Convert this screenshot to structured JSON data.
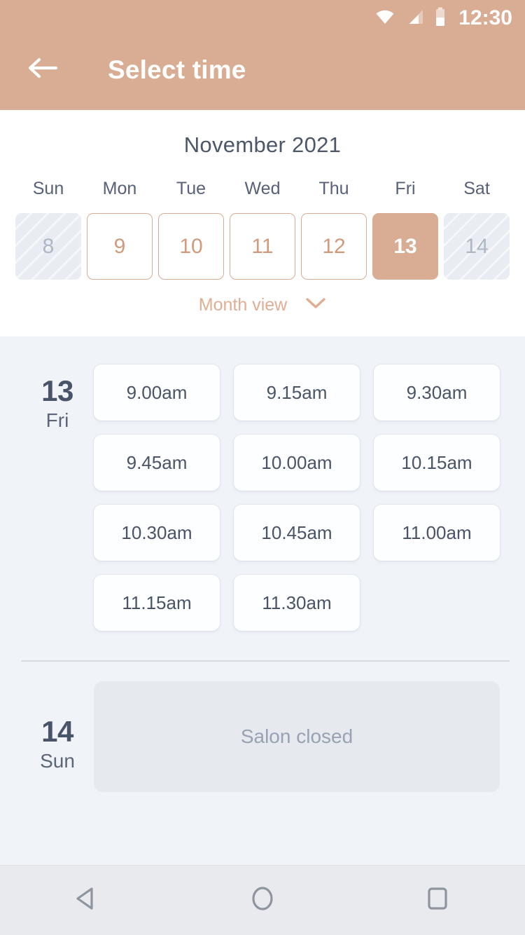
{
  "status_bar": {
    "time": "12:30",
    "icons": [
      "wifi-icon",
      "cellular-signal-icon",
      "battery-icon"
    ]
  },
  "app_bar": {
    "back_icon": "arrow-left-icon",
    "title": "Select time"
  },
  "calendar": {
    "month_title": "November 2021",
    "weekday_headers": [
      "Sun",
      "Mon",
      "Tue",
      "Wed",
      "Thu",
      "Fri",
      "Sat"
    ],
    "days": [
      {
        "number": "8",
        "state": "disabled"
      },
      {
        "number": "9",
        "state": "available"
      },
      {
        "number": "10",
        "state": "available"
      },
      {
        "number": "11",
        "state": "available"
      },
      {
        "number": "12",
        "state": "available"
      },
      {
        "number": "13",
        "state": "selected"
      },
      {
        "number": "14",
        "state": "disabled"
      }
    ],
    "month_view_toggle": {
      "label": "Month view",
      "icon": "chevron-down-icon"
    }
  },
  "schedule": {
    "days": [
      {
        "day_number": "13",
        "day_name": "Fri",
        "slots": [
          "9.00am",
          "9.15am",
          "9.30am",
          "9.45am",
          "10.00am",
          "10.15am",
          "10.30am",
          "10.45am",
          "11.00am",
          "11.15am",
          "11.30am"
        ]
      },
      {
        "day_number": "14",
        "day_name": "Sun",
        "closed_message": "Salon closed"
      }
    ]
  },
  "nav_bar": {
    "buttons": [
      {
        "name": "back-nav-button",
        "icon": "triangle-left-icon"
      },
      {
        "name": "home-nav-button",
        "icon": "circle-icon"
      },
      {
        "name": "recents-nav-button",
        "icon": "square-icon"
      }
    ]
  },
  "colors": {
    "accent": "#D9AC94",
    "accent_text": "#D29A7C",
    "page_background": "#F0F3F8",
    "card_background": "#FDFEFF",
    "text_dark": "#4A5468",
    "text_muted": "#99A2B4",
    "closed_card": "#E6E9EE"
  }
}
